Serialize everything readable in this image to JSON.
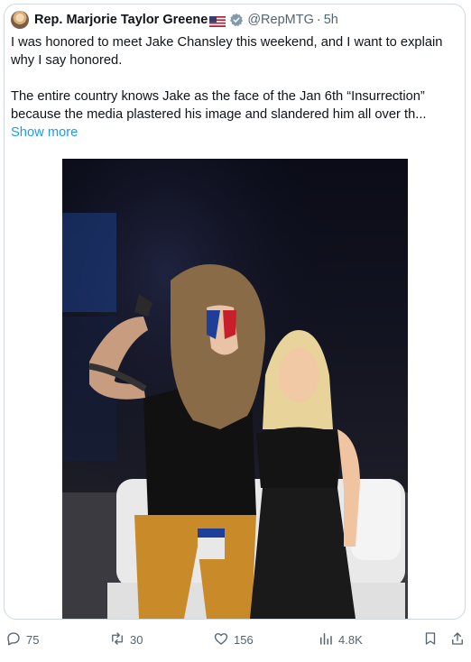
{
  "tweet": {
    "author_name": "Rep. Marjorie Taylor Greene",
    "handle": "@RepMTG",
    "separator": "·",
    "time": "5h",
    "paragraph1": "I was honored to meet Jake Chansley this weekend, and I want to explain why I say honored.",
    "paragraph2": "The entire country knows Jake as the face of the Jan 6th “Insurrection” because the media plastered his image and slandered him all over th...",
    "show_more": "Show more"
  },
  "actions": {
    "replies": "75",
    "reposts": "30",
    "likes": "156",
    "views": "4.8K"
  },
  "colors": {
    "link": "#1d9bf0",
    "muted": "#536471",
    "verified_badge": "#829aab"
  }
}
